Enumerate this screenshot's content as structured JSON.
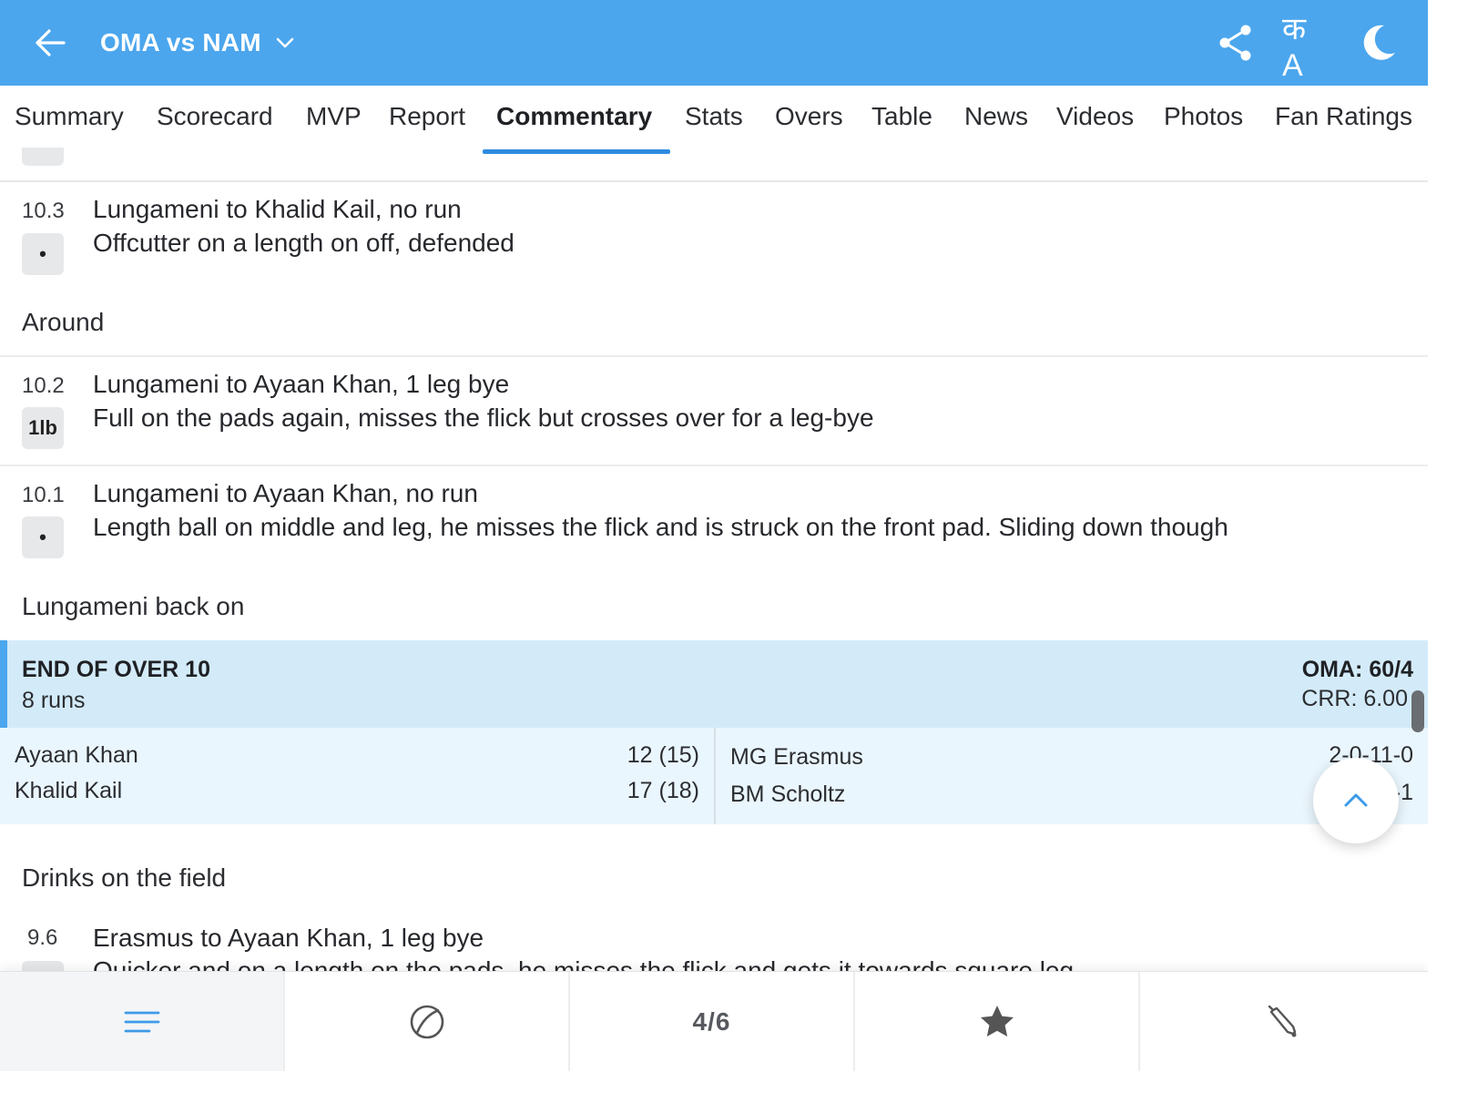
{
  "header": {
    "match_title": "OMA vs NAM",
    "language_label": "क A",
    "colors": {
      "bar": "#4ba6ed",
      "accent": "#2e8be0",
      "end_over_bg": "#d3ebf9"
    }
  },
  "tabs": [
    {
      "label": "Summary"
    },
    {
      "label": "Scorecard"
    },
    {
      "label": "MVP"
    },
    {
      "label": "Report"
    },
    {
      "label": "Commentary",
      "active": true
    },
    {
      "label": "Stats"
    },
    {
      "label": "Overs"
    },
    {
      "label": "Table"
    },
    {
      "label": "News"
    },
    {
      "label": "Videos"
    },
    {
      "label": "Photos"
    },
    {
      "label": "Fan Ratings"
    }
  ],
  "commentary": {
    "ball_1": {
      "over": "10.3",
      "badge": "•",
      "title": "Lungameni to Khalid Kail, no run",
      "text": "Offcutter on a length on off, defended"
    },
    "note_1": "Around",
    "ball_2": {
      "over": "10.2",
      "badge": "1lb",
      "title": "Lungameni to Ayaan Khan, 1 leg bye",
      "text": "Full on the pads again, misses the flick but crosses over for a leg-bye"
    },
    "ball_3": {
      "over": "10.1",
      "badge": "•",
      "title": "Lungameni to Ayaan Khan, no run",
      "text": "Length ball on middle and leg, he misses the flick and is struck on the front pad. Sliding down though"
    },
    "note_2": "Lungameni back on",
    "end_of_over": {
      "title": "END OF OVER 10",
      "runs": "8 runs",
      "score": "OMA: 60/4",
      "crr": "CRR: 6.00",
      "batters": [
        {
          "name": "Ayaan Khan",
          "score": "12 (15)"
        },
        {
          "name": "Khalid Kail",
          "score": "17 (18)"
        }
      ],
      "bowlers": [
        {
          "name": "MG Erasmus",
          "figures": "2-0-11-0"
        },
        {
          "name": "BM Scholtz",
          "figures": "-1"
        }
      ]
    },
    "note_3": "Drinks on the field",
    "ball_4": {
      "over": "9.6",
      "title": "Erasmus to Ayaan Khan, 1 leg bye",
      "text": "Quicker and on a length on the pads, he misses the flick and gets it towards square leg"
    }
  },
  "bottom_nav": {
    "items": [
      {
        "icon": "menu-lines-icon"
      },
      {
        "icon": "ball-icon"
      },
      {
        "label": "4/6"
      },
      {
        "icon": "star-icon"
      },
      {
        "icon": "bat-icon"
      }
    ]
  }
}
